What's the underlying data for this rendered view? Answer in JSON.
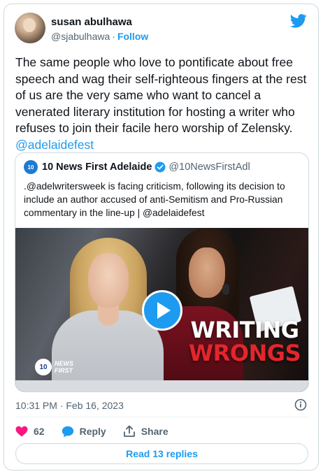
{
  "author": {
    "name": "susan abulhawa",
    "handle": "@sjabulhawa",
    "separator": "·",
    "follow_label": "Follow"
  },
  "tweet": {
    "text": "The same people who love to pontificate about free speech and wag their self-righteous fingers at the rest of us are the very same who want to cancel a venerated literary institution for hosting a writer who refuses to join their facile hero worship of Zelensky.",
    "mention": "@adelaidefest"
  },
  "quoted": {
    "logo_text": "10",
    "name": "10 News First Adelaide",
    "handle": "@10NewsFirstAdl",
    "text": ".@adelwritersweek is facing criticism, following its decision to include an author accused of anti-Semitism and Pro-Russian commentary in the line-up | @adelaidefest",
    "video": {
      "title_line1": "WRITING",
      "title_line2": "WRONGS",
      "logo_number": "10",
      "logo_line1": "NEWS",
      "logo_line2": "FIRST"
    }
  },
  "timestamp": "10:31 PM · Feb 16, 2023",
  "actions": {
    "like_count": "62",
    "reply_label": "Reply",
    "share_label": "Share"
  },
  "read_replies_label": "Read 13 replies",
  "colors": {
    "accent": "#1d9bf0",
    "like": "#f91880",
    "text": "#0f1419",
    "muted": "#536471",
    "border": "#cfd9de"
  },
  "icons": [
    "twitter-bird-icon",
    "verified-badge-icon",
    "play-icon",
    "info-icon",
    "heart-icon",
    "reply-bubble-icon",
    "share-icon"
  ]
}
